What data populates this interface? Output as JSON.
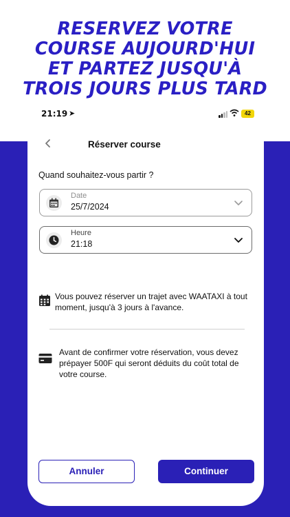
{
  "headline": {
    "lines": [
      "RESERVEZ VOTRE",
      "COURSE AUJOURD'HUI",
      "ET PARTEZ JUSQU'À",
      "TROIS JOURS PLUS TARD"
    ]
  },
  "status_bar": {
    "time": "21:19",
    "battery": "42"
  },
  "nav": {
    "title": "Réserver course"
  },
  "form": {
    "question": "Quand souhaitez-vous partir ?",
    "date_label": "Date",
    "date_value": "25/7/2024",
    "time_label": "Heure",
    "time_value": "21:18"
  },
  "info": {
    "booking_note": "Vous pouvez réserver un trajet avec WAATAXI à tout moment, jusqu'à 3 jours à l'avance.",
    "prepay_note": "Avant de confirmer votre réservation, vous devez prépayer 500F qui seront déduits du coût total de votre course."
  },
  "buttons": {
    "cancel": "Annuler",
    "continue": "Continuer"
  },
  "colors": {
    "brand_blue": "#2a20b6",
    "headline_blue": "#2a1fc4",
    "battery_yellow": "#f2d60a"
  }
}
